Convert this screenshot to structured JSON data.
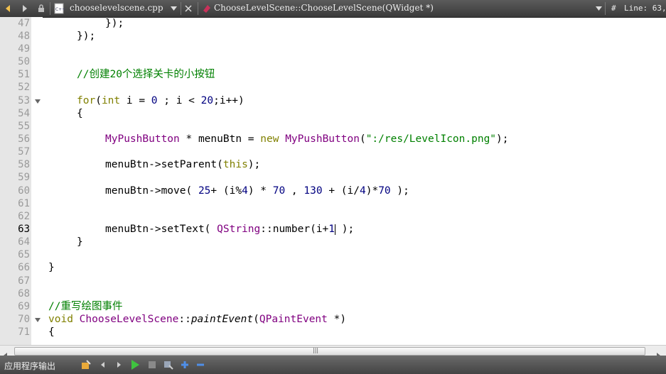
{
  "toolbar": {
    "file_name": "chooselevelscene.cpp",
    "function_name": "ChooseLevelScene::ChooseLevelScene(QWidget *)",
    "hash_label": "#",
    "line_info": "Line: 63,"
  },
  "line_numbers": [
    "47",
    "48",
    "49",
    "50",
    "51",
    "52",
    "53",
    "54",
    "55",
    "56",
    "57",
    "58",
    "59",
    "60",
    "61",
    "62",
    "63",
    "64",
    "65",
    "66",
    "67",
    "68",
    "69",
    "70",
    "71"
  ],
  "code": {
    "l47": "});",
    "l48": "});",
    "l51_comment": "//创建20个选择关卡的小按钮",
    "l53_for": "for",
    "l53_int": "int",
    "l53_a": " i = ",
    "l53_zero": "0",
    "l53_b": " ; i < ",
    "l53_twenty": "20",
    "l53_c": ";i++)",
    "l54": "{",
    "l56_type": "MyPushButton",
    "l56_a": " * menuBtn = ",
    "l56_new": "new",
    "l56_type2": "MyPushButton",
    "l56_str": "\":/res/LevelIcon.png\"",
    "l56_end": ");",
    "l58_a": "menuBtn->setParent(",
    "l58_this": "this",
    "l58_end": ");",
    "l60_a": "menuBtn->move( ",
    "l60_25": "25",
    "l60_b": "+ (i%",
    "l60_4": "4",
    "l60_c": ") * ",
    "l60_70": "70",
    "l60_d": " , ",
    "l60_130": "130",
    "l60_e": " + (i/",
    "l60_4b": "4",
    "l60_f": ")*",
    "l60_70b": "70",
    "l60_g": " );",
    "l63_a": "menuBtn->setText( ",
    "l63_qs": "QString",
    "l63_b": "::number(i+",
    "l63_1": "1",
    "l63_c": " );",
    "l64": "}",
    "l66": "}",
    "l69_comment": "//重写绘图事件",
    "l70_void": "void",
    "l70_cls": "ChooseLevelScene",
    "l70_sep": "::",
    "l70_fn": "paintEvent",
    "l70_type": "QPaintEvent",
    "l70_end": " *)",
    "l71": "{"
  },
  "status": {
    "panel_title": "应用程序输出"
  }
}
